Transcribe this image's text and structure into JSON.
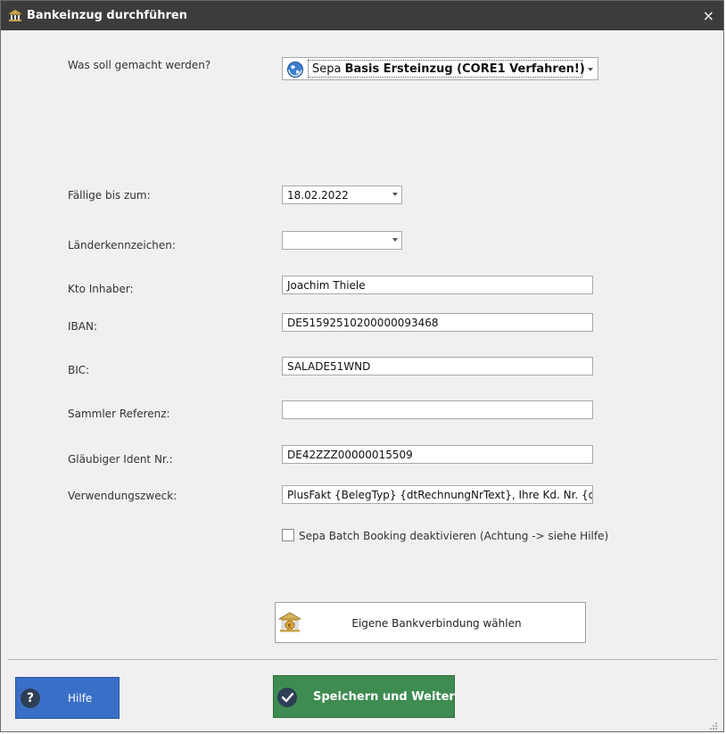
{
  "window": {
    "title": "Bankeinzug durchführen",
    "close_symbol": "×",
    "icon": "bank-icon"
  },
  "mode": {
    "label": "Was soll gemacht werden?",
    "value_prefix": "Sepa ",
    "value_bold": "Basis Ersteinzug (CORE1 Verfahren!)",
    "icon": "globe-icon"
  },
  "fields": {
    "due_label": "Fällige bis zum:",
    "due_value": "18.02.2022",
    "country_label": "Länderkennzeichen:",
    "country_value": "",
    "holder_label": "Kto Inhaber:",
    "holder_value": "Joachim Thiele",
    "iban_label": "IBAN:",
    "iban_value": "DE51592510200000093468",
    "bic_label": "BIC:",
    "bic_value": "SALADE51WND",
    "collector_label": "Sammler Referenz:",
    "collector_value": "",
    "creditor_label": "Gläubiger Ident Nr.:",
    "creditor_value": "DE42ZZZ00000015509",
    "purpose_label": "Verwendungszweck:",
    "purpose_value": "PlusFakt {BelegTyp} {dtRechnungNrText}, Ihre Kd. Nr. {dtK"
  },
  "batch": {
    "label": "Sepa Batch Booking deaktivieren (Achtung -> siehe Hilfe)",
    "checked": false
  },
  "buttons": {
    "bank_label": "Eigene Bankverbindung wählen",
    "help_label": "Hilfe",
    "help_symbol": "?",
    "save_label": "Speichern und Weiter"
  },
  "colors": {
    "titlebar": "#3c3c3c",
    "help_button": "#3a6fc7",
    "save_button": "#3f8c52"
  }
}
